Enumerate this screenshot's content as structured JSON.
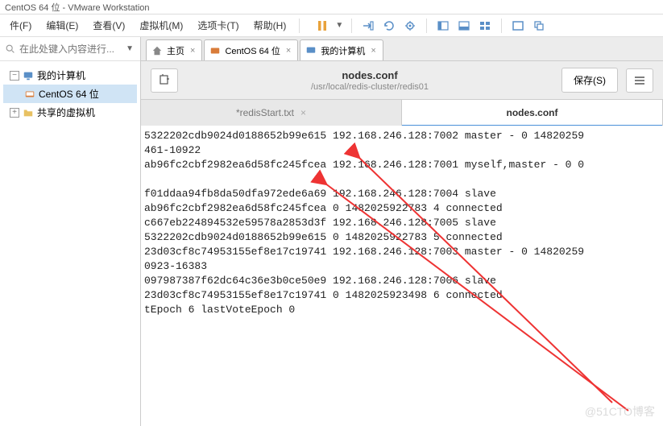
{
  "window": {
    "title": "CentOS 64 位 - VMware Workstation"
  },
  "menu": {
    "items": [
      "件(F)",
      "编辑(E)",
      "查看(V)",
      "虚拟机(M)",
      "选项卡(T)",
      "帮助(H)"
    ]
  },
  "sidebar": {
    "search_placeholder": "在此处键入内容进行...",
    "tree": [
      {
        "label": "我的计算机",
        "icon": "monitor",
        "expanded": true
      },
      {
        "label": "CentOS 64 位",
        "icon": "vm",
        "selected": true,
        "level": 2
      },
      {
        "label": "共享的虚拟机",
        "icon": "folder-share",
        "level": 1
      }
    ]
  },
  "doc_tabs": [
    {
      "label": "主页",
      "icon": "home"
    },
    {
      "label": "CentOS 64 位",
      "icon": "vm",
      "active": true
    },
    {
      "label": "我的计算机",
      "icon": "monitor"
    }
  ],
  "editor": {
    "file_name": "nodes.conf",
    "file_path": "/usr/local/redis-cluster/redis01",
    "save_label": "保存(S)"
  },
  "file_tabs": [
    {
      "label": "*redisStart.txt",
      "active": false
    },
    {
      "label": "nodes.conf",
      "active": true
    }
  ],
  "text_lines": [
    "5322202cdb9024d0188652b99e615 192.168.246.128:7002 master - 0 14820259",
    "461-10922",
    "ab96fc2cbf2982ea6d58fc245fcea 192.168.246.128:7001 myself,master - 0 0",
    "",
    "f01ddaa94fb8da50dfa972ede6a69 192.168.246.128:7004 slave",
    "ab96fc2cbf2982ea6d58fc245fcea 0 1482025922783 4 connected",
    "c667eb224894532e59578a2853d3f 192.168.246.128:7005 slave",
    "5322202cdb9024d0188652b99e615 0 1482025922783 5 connected",
    "23d03cf8c74953155ef8e17c19741 192.168.246.128:7003 master - 0 14820259",
    "0923-16383",
    "097987387f62dc64c36e3b0ce50e9 192.168.246.128:7006 slave",
    "23d03cf8c74953155ef8e17c19741 0 1482025923498 6 connected",
    "tEpoch 6 lastVoteEpoch 0"
  ],
  "watermark": "@51CTO博客"
}
